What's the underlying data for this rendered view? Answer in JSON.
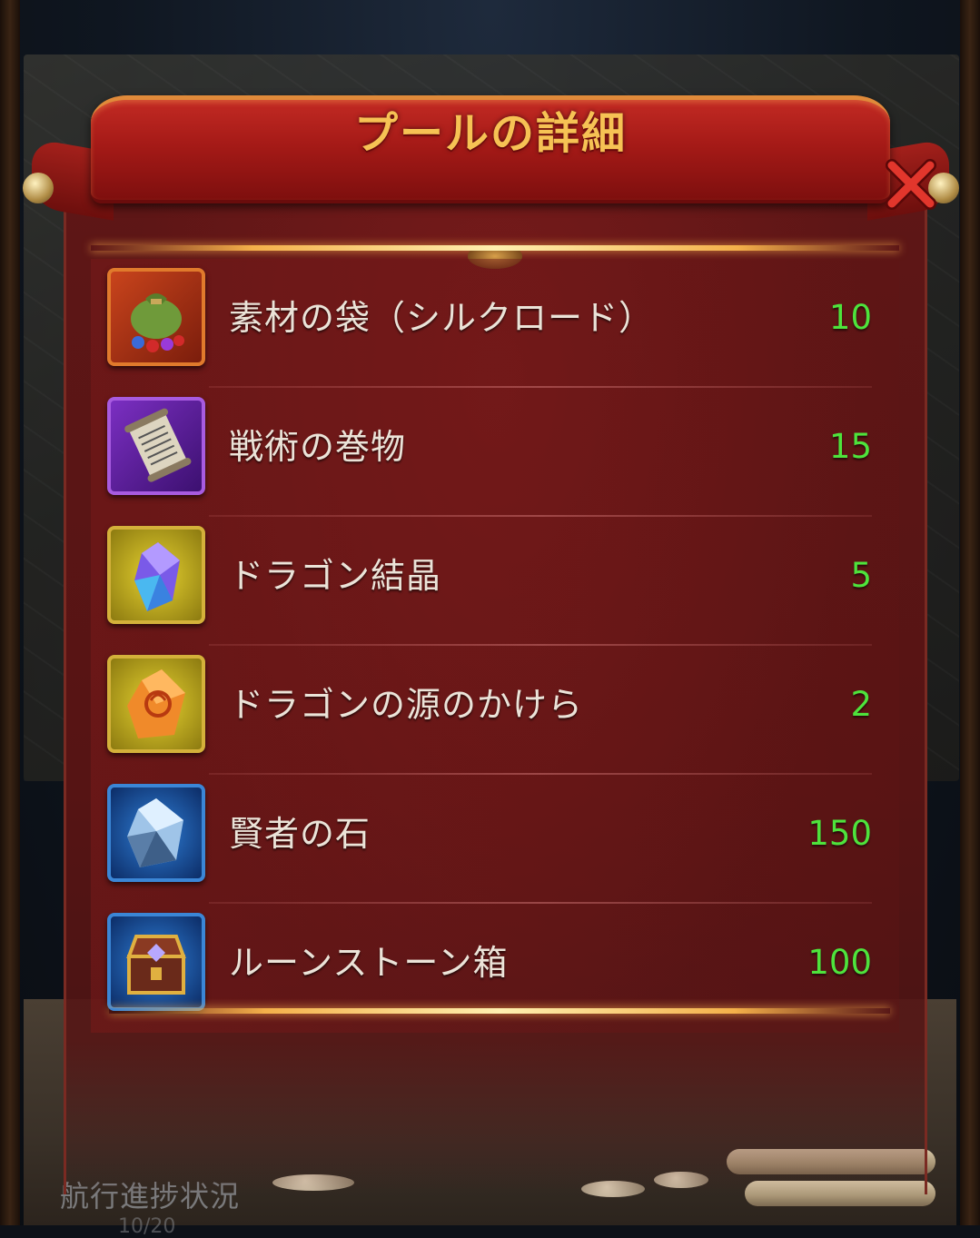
{
  "dialog": {
    "title": "プールの詳細"
  },
  "items": [
    {
      "name": "素材の袋（シルクロード）",
      "quantity": "10",
      "icon": "material-bag-icon",
      "frame": "orange"
    },
    {
      "name": "戦術の巻物",
      "quantity": "15",
      "icon": "tactics-scroll-icon",
      "frame": "purple"
    },
    {
      "name": "ドラゴン結晶",
      "quantity": "5",
      "icon": "dragon-crystal-icon",
      "frame": "gold"
    },
    {
      "name": "ドラゴンの源のかけら",
      "quantity": "2",
      "icon": "dragon-source-shard-icon",
      "frame": "gold"
    },
    {
      "name": "賢者の石",
      "quantity": "150",
      "icon": "philosophers-stone-icon",
      "frame": "blue"
    },
    {
      "name": "ルーンストーン箱",
      "quantity": "100",
      "icon": "runestone-chest-icon",
      "frame": "blue"
    }
  ],
  "background": {
    "voyage_progress_label": "航行進捗状況",
    "voyage_progress_value": "10/20"
  },
  "colors": {
    "title_gold": "#f6c254",
    "quantity_green": "#4ee33c",
    "panel_red": "#5e1616",
    "banner_red": "#b5221c"
  }
}
